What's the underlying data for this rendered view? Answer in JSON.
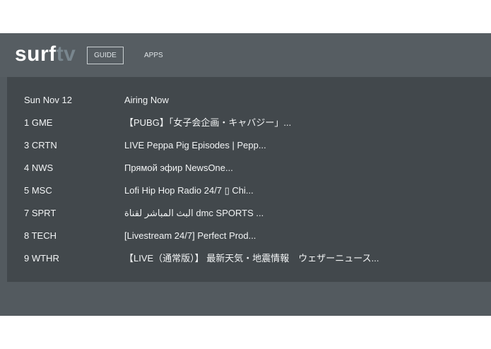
{
  "brand": {
    "primary": "surf",
    "secondary": "tv"
  },
  "nav": {
    "guide_label": "GUIDE",
    "apps_label": "APPS"
  },
  "guide": {
    "header": {
      "date": "Sun Nov 12",
      "column_label": "Airing Now"
    },
    "rows": [
      {
        "channel": "1 GME",
        "program": "【PUBG】「女子会企画・キャバジー」..."
      },
      {
        "channel": "3 CRTN",
        "program": "LIVE Peppa Pig Episodes | Pepp..."
      },
      {
        "channel": "4 NWS",
        "program": "Прямой эфир NewsOne..."
      },
      {
        "channel": "5 MSC",
        "program": "Lofi Hip Hop Radio 24/7 ▯ Chi..."
      },
      {
        "channel": "7 SPRT",
        "program": "البث المباشر لقناة dmc SPORTS ..."
      },
      {
        "channel": "8 TECH",
        "program": "[Livestream 24/7] Perfect Prod..."
      },
      {
        "channel": "9 WTHR",
        "program": "【LIVE（通常版）】 最新天気・地震情報　ウェザーニュース..."
      }
    ]
  },
  "colors": {
    "page_background": "#ffffff",
    "app_background": "#535a5f",
    "panel_background": "#42484c",
    "logo_accent": "#79868e",
    "text": "#f2f4f5"
  }
}
